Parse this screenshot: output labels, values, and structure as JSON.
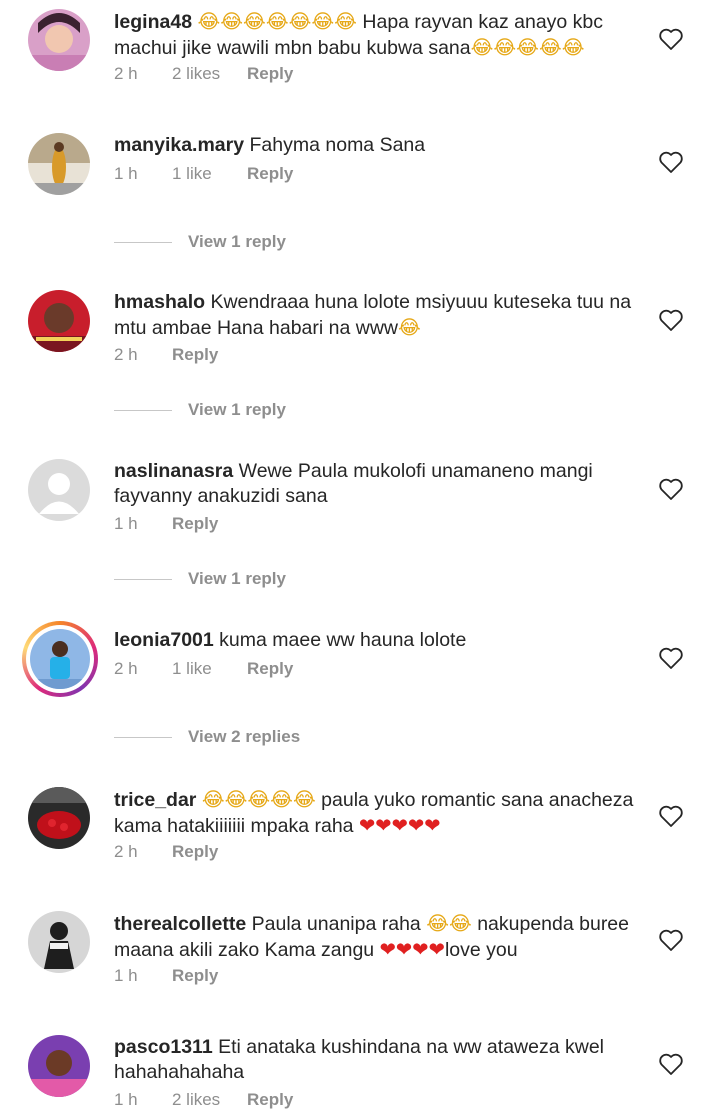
{
  "comments": [
    {
      "username": "legina48",
      "text_before": "",
      "emojis_before": "😂😂😂😂😂😂😂",
      "text": " Hapa  rayvan kaz anayo kbc machui jike  wawili mbn babu kubwa sana",
      "emojis_after": "😂😂😂😂😂",
      "time": "2 h",
      "likes": "2 likes",
      "reply": "Reply"
    },
    {
      "username": "manyika.mary",
      "text": "Fahyma noma Sana",
      "time": "1 h",
      "likes": "1 like",
      "reply": "Reply",
      "view_replies": "View 1 reply"
    },
    {
      "username": "hmashalo",
      "text": "Kwendraaa huna lolote msiyuuu kuteseka tuu na mtu ambae Hana habari na www",
      "emojis_after": "😂",
      "time": "2 h",
      "reply": "Reply",
      "view_replies": "View 1 reply"
    },
    {
      "username": "naslinanasra",
      "text": "Wewe Paula mukolofi unamaneno mangi fayvanny anakuzidi sana",
      "time": "1 h",
      "reply": "Reply",
      "view_replies": "View 1 reply"
    },
    {
      "username": "leonia7001",
      "text": "kuma maee ww hauna lolote",
      "time": "2 h",
      "likes": "1 like",
      "reply": "Reply",
      "view_replies": "View 2 replies"
    },
    {
      "username": "trice_dar",
      "emojis_before": "😂😂😂😂😂",
      "text": " paula yuko romantic sana anacheza kama hatakiiiiiii mpaka raha ",
      "hearts": "❤❤❤❤❤",
      "time": "2 h",
      "reply": "Reply"
    },
    {
      "username": "therealcollette",
      "text": "Paula unanipa raha ",
      "emojis_mid": "😂😂",
      "text2": " nakupenda buree maana akili zako Kama zangu ",
      "hearts": "❤❤❤❤",
      "text3": "love you",
      "time": "1 h",
      "reply": "Reply"
    },
    {
      "username": "pasco1311",
      "text": "Eti anataka kushindana na ww ataweza kwel hahahahahaha",
      "time": "1 h",
      "likes": "2 likes",
      "reply": "Reply"
    }
  ],
  "colors": {
    "text": "#262626",
    "meta": "#8e8e8e",
    "heart": "#e02020"
  }
}
